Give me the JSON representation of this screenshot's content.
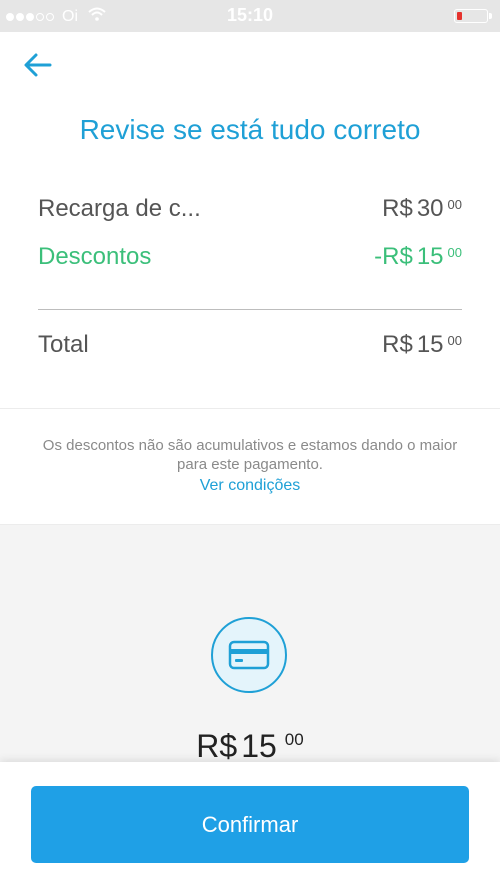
{
  "status_bar": {
    "carrier": "Oi",
    "time": "15:10",
    "battery_color": "#e5322d"
  },
  "header": {
    "back_icon": "arrow-left-icon",
    "title": "Revise se está tudo correto"
  },
  "summary": {
    "recharge": {
      "label": "Recarga de c...",
      "currency": "R$",
      "amount": "30",
      "cents": "00"
    },
    "discount": {
      "label": "Descontos",
      "currency": "-R$",
      "amount": "15",
      "cents": "00"
    },
    "total": {
      "label": "Total",
      "currency": "R$",
      "amount": "15",
      "cents": "00"
    }
  },
  "notice": {
    "text": "Os descontos não são acumulativos e estamos dando o maior para este pagamento.",
    "link": "Ver condições"
  },
  "payment": {
    "icon": "credit-card-icon",
    "currency": "R$",
    "amount": "15",
    "cents": "00"
  },
  "actions": {
    "confirm_label": "Confirmar"
  },
  "colors": {
    "accent": "#1fa0d6",
    "discount_green": "#3bbf7a",
    "button": "#1fa0e6"
  }
}
